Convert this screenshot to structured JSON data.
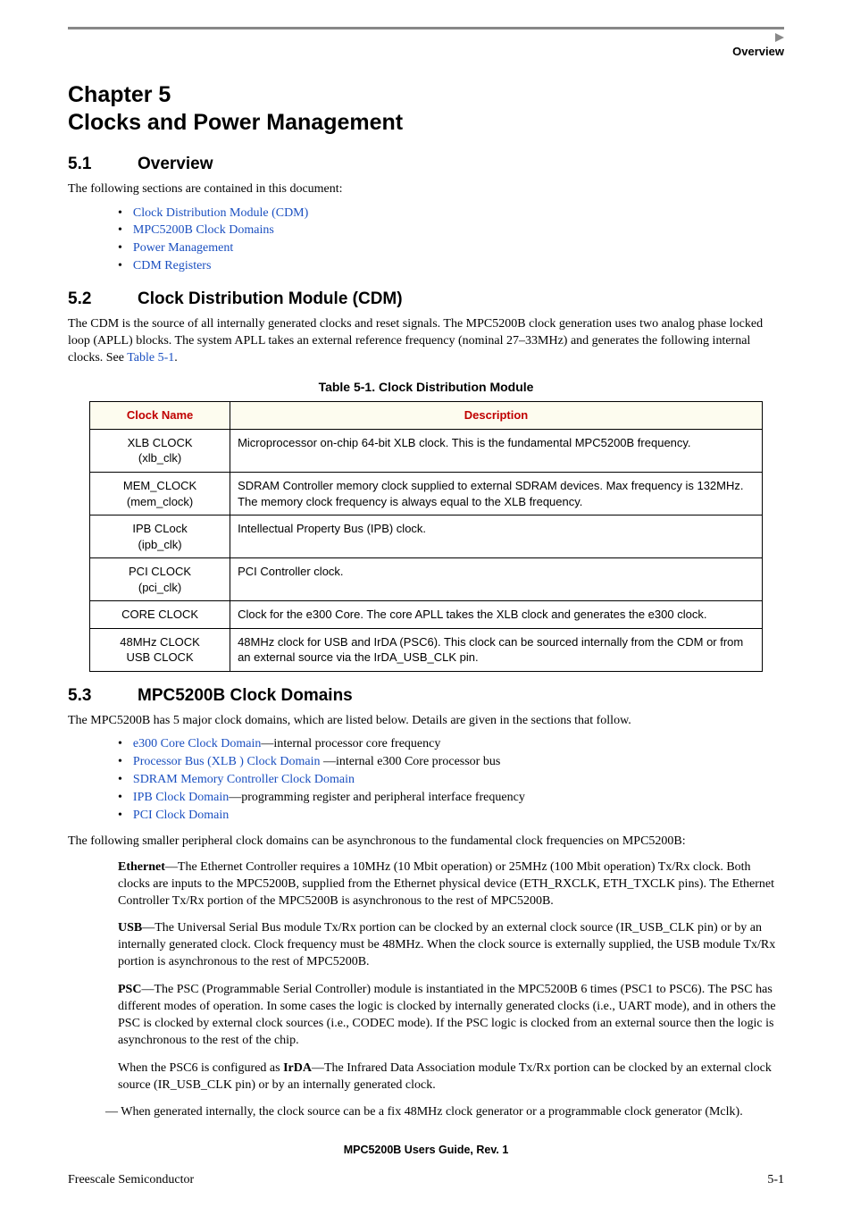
{
  "header": {
    "right_label": "Overview"
  },
  "chapter": {
    "line1": "Chapter 5",
    "line2": "Clocks and Power Management"
  },
  "s1": {
    "num": "5.1",
    "title": "Overview",
    "intro": "The following sections are contained in this document:",
    "links": [
      "Clock Distribution Module (CDM)",
      "MPC5200B Clock Domains",
      "Power Management",
      "CDM Registers"
    ]
  },
  "s2": {
    "num": "5.2",
    "title": "Clock Distribution Module (CDM)",
    "body_a": "The CDM is the source of all internally generated clocks and reset signals. The MPC5200B clock generation uses two analog phase locked loop (APLL) blocks. The system APLL takes an external reference frequency (nominal 27–33MHz) and generates the following internal clocks. See ",
    "body_link": "Table 5-1",
    "body_b": ".",
    "table_caption": "Table 5-1. Clock Distribution Module",
    "th1": "Clock Name",
    "th2": "Description",
    "rows": [
      {
        "name_l1": "XLB CLOCK",
        "name_l2": "(xlb_clk)",
        "desc": "Microprocessor on-chip 64-bit XLB clock. This is the fundamental MPC5200B frequency."
      },
      {
        "name_l1": "MEM_CLOCK",
        "name_l2": "(mem_clock)",
        "desc": "SDRAM Controller memory clock supplied to external SDRAM devices. Max frequency is 132MHz. The memory clock frequency is always equal to the XLB frequency."
      },
      {
        "name_l1": "IPB CLock",
        "name_l2": "(ipb_clk)",
        "desc": "Intellectual Property Bus (IPB) clock."
      },
      {
        "name_l1": "PCI CLOCK",
        "name_l2": "(pci_clk)",
        "desc": "PCI Controller clock."
      },
      {
        "name_l1": "CORE CLOCK",
        "name_l2": "",
        "desc": "Clock for the e300 Core. The core APLL takes the XLB clock and generates the e300 clock."
      },
      {
        "name_l1": "48MHz CLOCK",
        "name_l2": "USB CLOCK",
        "desc": "48MHz clock for USB and IrDA (PSC6). This clock can be sourced internally from the CDM or from an external source via the IrDA_USB_CLK pin."
      }
    ]
  },
  "s3": {
    "num": "5.3",
    "title": "MPC5200B Clock Domains",
    "intro": "The MPC5200B has 5 major clock domains, which are listed below. Details are given in the sections that follow.",
    "items": [
      {
        "link": "e300 Core Clock Domain",
        "rest": "—internal processor core frequency"
      },
      {
        "link": "Processor Bus (XLB ) Clock Domain ",
        "rest": "—internal e300 Core processor bus"
      },
      {
        "link": "SDRAM Memory Controller Clock Domain",
        "rest": ""
      },
      {
        "link": "IPB Clock Domain",
        "rest": "—programming register and peripheral interface frequency"
      },
      {
        "link": "PCI Clock Domain",
        "rest": ""
      }
    ],
    "after": "The following smaller peripheral clock domains can be asynchronous to the fundamental clock frequencies on MPC5200B:",
    "ethernet_label": "Ethernet",
    "ethernet": "—The Ethernet Controller requires a 10MHz (10 Mbit operation) or 25MHz (100 Mbit operation) Tx/Rx clock. Both clocks are inputs to the MPC5200B, supplied from the Ethernet physical device (ETH_RXCLK, ETH_TXCLK pins). The Ethernet Controller Tx/Rx portion of the MPC5200B is asynchronous to the rest of MPC5200B.",
    "usb_label": "USB",
    "usb": "—The Universal Serial Bus module Tx/Rx portion can be clocked by an external clock source (IR_USB_CLK pin) or by an internally generated clock. Clock frequency must be 48MHz. When the clock source is externally supplied, the USB module Tx/Rx portion is asynchronous to the rest of MPC5200B.",
    "psc_label": "PSC",
    "psc": "—The PSC (Programmable Serial Controller) module is instantiated in the MPC5200B 6 times (PSC1 to PSC6). The PSC has different modes of operation. In some cases the logic is clocked by internally generated clocks (i.e., UART mode), and in others the PSC is clocked by external clock sources (i.e., CODEC mode). If the PSC logic is clocked from an external source then the logic is asynchronous to the rest of the chip.",
    "irda_a": "When the PSC6 is configured as ",
    "irda_label": "IrDA",
    "irda_b": "—The Infrared Data Association module Tx/Rx portion can be clocked by an external clock source (IR_USB_CLK pin) or by an internally generated clock.",
    "dash": "— When generated internally, the clock source can be a fix 48MHz clock generator or a programmable clock generator (Mclk)."
  },
  "footer": {
    "doc": "MPC5200B Users Guide, Rev. 1",
    "left": "Freescale Semiconductor",
    "right": "5-1"
  }
}
